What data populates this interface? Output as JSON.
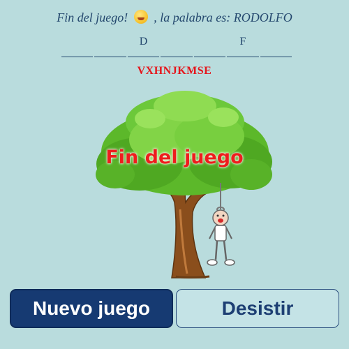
{
  "status": {
    "prefix": "Fin del juego!",
    "emoji": "rofl-face-icon",
    "suffix": ", la palabra es: RODOLFO"
  },
  "word_slots": [
    "",
    "",
    "D",
    "",
    "",
    "F",
    ""
  ],
  "wrong_letters": "VXHNJKMSE",
  "overlay_text": "Fin del juego",
  "buttons": {
    "new_game": "Nuevo juego",
    "give_up": "Desistir"
  },
  "colors": {
    "background": "#b9dcdd",
    "primary": "#163a72",
    "wrong_letters": "#e5161c",
    "overlay": "#ee1d1d"
  }
}
